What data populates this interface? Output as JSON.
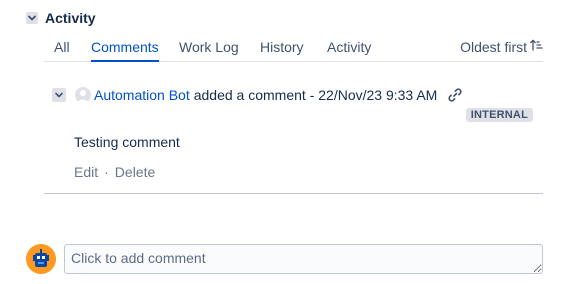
{
  "section": {
    "title": "Activity"
  },
  "tabs": [
    {
      "label": "All",
      "active": false
    },
    {
      "label": "Comments",
      "active": true
    },
    {
      "label": "Work Log",
      "active": false
    },
    {
      "label": "History",
      "active": false
    },
    {
      "label": "Activity",
      "active": false
    }
  ],
  "sort": {
    "label": "Oldest first",
    "icon": "sort-ascending-icon"
  },
  "comment": {
    "author": "Automation Bot",
    "action_text": "added a comment - 22/Nov/23 9:33 AM",
    "visibility_badge": "INTERNAL",
    "body": "Testing comment",
    "edit_label": "Edit",
    "separator": "·",
    "delete_label": "Delete"
  },
  "add_comment": {
    "placeholder": "Click to add comment"
  },
  "colors": {
    "link": "#0052cc",
    "text": "#172b4d",
    "muted": "#6b778c",
    "badge_bg": "#dfe1e6",
    "avatar_bg": "#ff991f"
  }
}
